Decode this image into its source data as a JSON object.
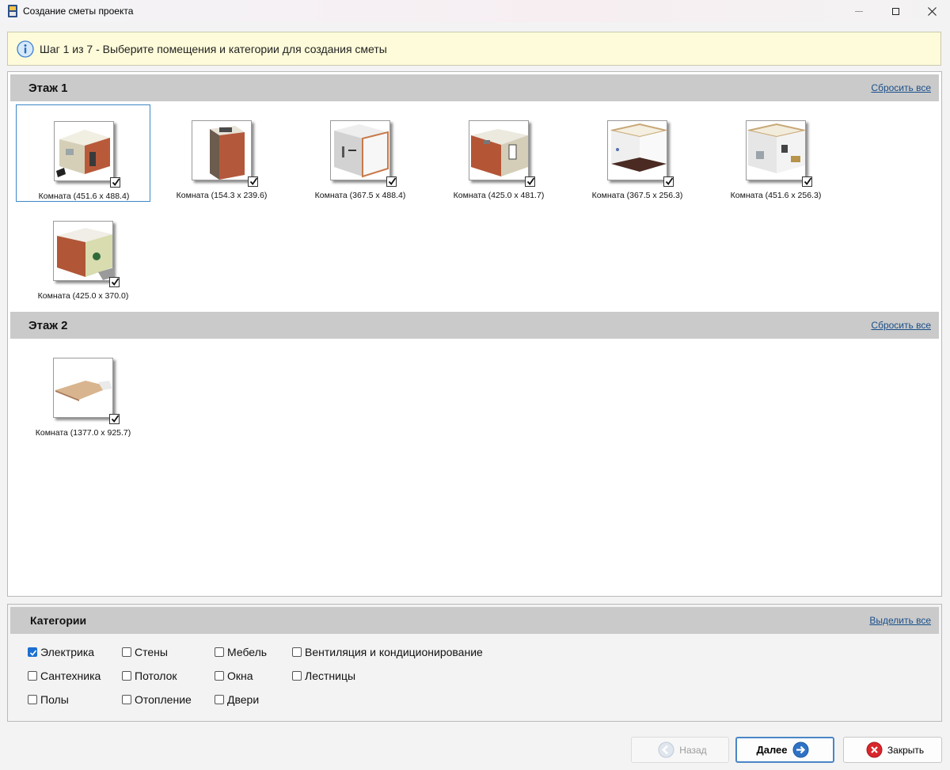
{
  "window": {
    "title": "Создание сметы проекта"
  },
  "banner": {
    "text": "Шаг 1 из 7 - Выберите помещения и категории для создания сметы"
  },
  "floors": [
    {
      "title": "Этаж 1",
      "reset_label": "Сбросить все",
      "rooms": [
        {
          "label": "Комната (451.6 x 488.4)",
          "checked": true,
          "selected": true
        },
        {
          "label": "Комната (154.3 x 239.6)",
          "checked": true
        },
        {
          "label": "Комната (367.5 x 488.4)",
          "checked": true
        },
        {
          "label": "Комната (425.0 x 481.7)",
          "checked": true
        },
        {
          "label": "Комната (367.5 x 256.3)",
          "checked": true
        },
        {
          "label": "Комната (451.6 x 256.3)",
          "checked": true
        },
        {
          "label": "Комната (425.0 x 370.0)",
          "checked": true
        }
      ]
    },
    {
      "title": "Этаж 2",
      "reset_label": "Сбросить все",
      "rooms": [
        {
          "label": "Комната (1377.0 x 925.7)",
          "checked": true
        }
      ]
    }
  ],
  "categories": {
    "title": "Категории",
    "select_all_label": "Выделить все",
    "items": [
      {
        "label": "Электрика",
        "checked": true
      },
      {
        "label": "Сантехника",
        "checked": false
      },
      {
        "label": "Полы",
        "checked": false
      },
      {
        "label": "Стены",
        "checked": false
      },
      {
        "label": "Потолок",
        "checked": false
      },
      {
        "label": "Отопление",
        "checked": false
      },
      {
        "label": "Мебель",
        "checked": false
      },
      {
        "label": "Окна",
        "checked": false
      },
      {
        "label": "Двери",
        "checked": false
      },
      {
        "label": "Вентиляция и кондиционирование",
        "checked": false
      },
      {
        "label": "Лестницы",
        "checked": false
      }
    ]
  },
  "buttons": {
    "back_label": "Назад",
    "next_label": "Далее",
    "close_label": "Закрыть"
  },
  "colors": {
    "banner_bg": "#fdfbd9",
    "header_bg": "#cacaca",
    "link": "#1a4f8a",
    "accent": "#1b6fd1"
  }
}
